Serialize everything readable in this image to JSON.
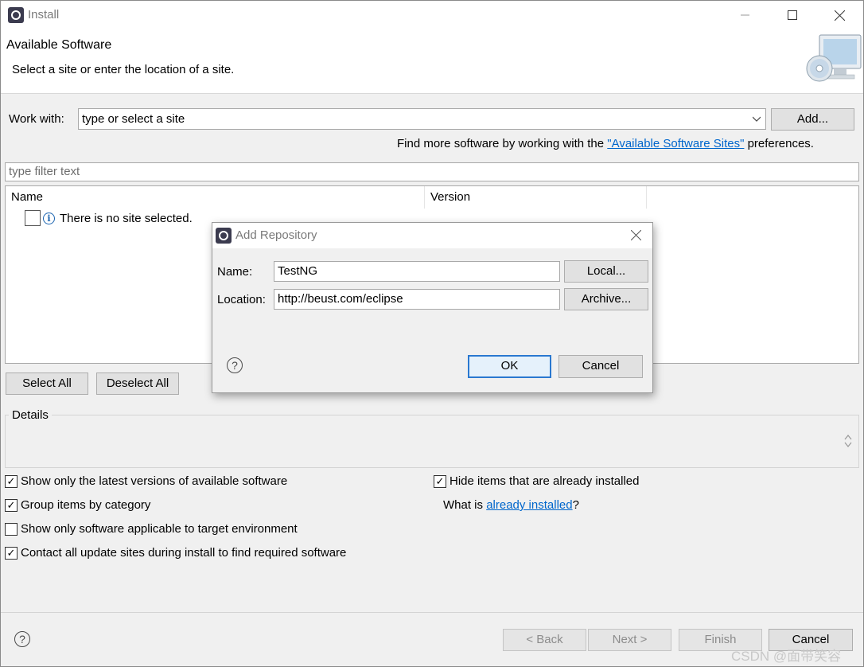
{
  "window": {
    "title": "Install"
  },
  "header": {
    "title": "Available Software",
    "subtitle": "Select a site or enter the location of a site.",
    "banner_icon": "cd-monitor-icon"
  },
  "work_with": {
    "label": "Work with:",
    "value": "type or select a site",
    "add_label": "Add..."
  },
  "find_more": {
    "prefix": "Find more software by working with the ",
    "link": "\"Available Software Sites\"",
    "suffix": " preferences."
  },
  "filter": {
    "placeholder": "type filter text"
  },
  "tree": {
    "columns": [
      "Name",
      "Version"
    ],
    "rows": [
      {
        "label": "There is no site selected."
      }
    ]
  },
  "buttons": {
    "select_all": "Select All",
    "deselect_all": "Deselect All",
    "back": "< Back",
    "next": "Next >",
    "finish": "Finish",
    "cancel": "Cancel"
  },
  "details": {
    "label": "Details"
  },
  "options": {
    "latest": {
      "label": "Show only the latest versions of available software",
      "checked": true
    },
    "group": {
      "label": "Group items by category",
      "checked": true
    },
    "applicable": {
      "label": "Show only software applicable to target environment",
      "checked": false
    },
    "contact": {
      "label": "Contact all update sites during install to find required software",
      "checked": true
    },
    "hide": {
      "label": "Hide items that are already installed",
      "checked": true
    }
  },
  "what_is": {
    "prefix": "What is ",
    "link": "already installed",
    "suffix": "?"
  },
  "dialog": {
    "title": "Add Repository",
    "name_label": "Name:",
    "name_value": "TestNG",
    "location_label": "Location:",
    "location_value": "http://beust.com/eclipse",
    "local": "Local...",
    "archive": "Archive...",
    "ok": "OK",
    "cancel": "Cancel"
  },
  "watermark": "CSDN @面带笑容"
}
